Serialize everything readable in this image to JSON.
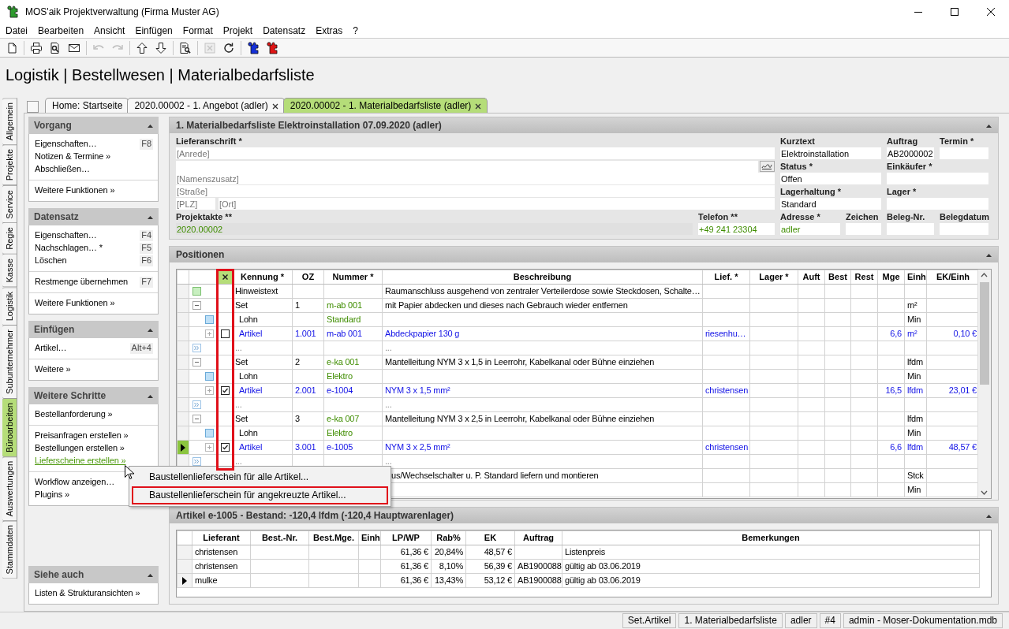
{
  "window": {
    "title": "MOS'aik Projektverwaltung (Firma Muster AG)"
  },
  "menu": [
    "Datei",
    "Bearbeiten",
    "Ansicht",
    "Einfügen",
    "Format",
    "Projekt",
    "Datensatz",
    "Extras",
    "?"
  ],
  "toolbar": {
    "groups": [
      [
        {
          "disabled": false
        }
      ],
      [
        {
          "disabled": false
        },
        {
          "disabled": false
        },
        {
          "disabled": false
        }
      ],
      [
        {
          "disabled": true
        },
        {
          "disabled": true
        }
      ],
      [
        {
          "disabled": false
        },
        {
          "disabled": false
        }
      ],
      [
        {
          "disabled": false
        }
      ],
      [
        {
          "disabled": true
        },
        {
          "disabled": false
        }
      ],
      [
        {
          "disabled": false
        },
        {
          "disabled": false
        }
      ]
    ]
  },
  "heading": "Logistik | Bestellwesen | Materialbedarfsliste",
  "side_tabs": [
    {
      "label": "Allgemein",
      "selected": false
    },
    {
      "label": "Projekte",
      "selected": false
    },
    {
      "label": "Service",
      "selected": false
    },
    {
      "label": "Regie",
      "selected": false
    },
    {
      "label": "Kasse",
      "selected": false
    },
    {
      "label": "Logistik",
      "selected": false
    },
    {
      "label": "Subunternehmer",
      "selected": false
    },
    {
      "label": "Büroarbeiten",
      "selected": true
    },
    {
      "label": "Auswertungen",
      "selected": false
    },
    {
      "label": "Stammdaten",
      "selected": false
    }
  ],
  "doc_tabs": [
    {
      "label": "Home: Startseite",
      "selected": false,
      "closable": false
    },
    {
      "label": "2020.00002 - 1. Angebot (adler)",
      "selected": false,
      "closable": true
    },
    {
      "label": "2020.00002 - 1. Materialbedarfsliste (adler)",
      "selected": true,
      "closable": true
    }
  ],
  "task_pane": [
    {
      "title": "Vorgang",
      "expanded": true,
      "pinned_bottom": false,
      "sections": [
        [
          {
            "label": "Eigenschaften…",
            "shortcut": "F8",
            "active": false
          },
          {
            "label": "Notizen & Termine »",
            "active": false
          },
          {
            "label": "Abschließen…",
            "active": false
          }
        ],
        [
          {
            "label": "Weitere Funktionen »",
            "active": false
          }
        ]
      ]
    },
    {
      "title": "Datensatz",
      "expanded": true,
      "pinned_bottom": false,
      "sections": [
        [
          {
            "label": "Eigenschaften…",
            "shortcut": "F4",
            "active": false
          },
          {
            "label": "Nachschlagen… *",
            "shortcut": "F5",
            "active": false
          },
          {
            "label": "Löschen",
            "shortcut": "F6",
            "active": false
          }
        ],
        [
          {
            "label": "Restmenge übernehmen",
            "shortcut": "F7",
            "active": false
          }
        ],
        [
          {
            "label": "Weitere Funktionen »",
            "active": false
          }
        ]
      ]
    },
    {
      "title": "Einfügen",
      "expanded": true,
      "pinned_bottom": false,
      "sections": [
        [
          {
            "label": "Artikel…",
            "shortcut": "Alt+4",
            "active": false
          }
        ],
        [
          {
            "label": "Weitere »",
            "active": false
          }
        ]
      ]
    },
    {
      "title": "Weitere Schritte",
      "expanded": true,
      "pinned_bottom": false,
      "sections": [
        [
          {
            "label": "Bestellanforderung »",
            "active": false
          }
        ],
        [
          {
            "label": "Preisanfragen erstellen »",
            "active": false
          },
          {
            "label": "Bestellungen erstellen »",
            "active": false
          },
          {
            "label": "Lieferscheine erstellen »",
            "active": true
          }
        ],
        [
          {
            "label": "Workflow anzeigen…",
            "active": false
          },
          {
            "label": "Plugins »",
            "active": false
          }
        ]
      ]
    },
    {
      "title": "Siehe auch",
      "expanded": true,
      "pinned_bottom": true,
      "sections": [
        [
          {
            "label": "Listen & Strukturansichten »",
            "active": false
          }
        ]
      ]
    }
  ],
  "order_form": {
    "title": "1. Materialbedarfsliste Elektroinstallation 07.09.2020 (adler)",
    "expanded": true,
    "address_label": "Lieferanschrift *",
    "address_lines": [
      {
        "kind": "text",
        "placeholder": "[Anrede]"
      },
      {
        "kind": "signature"
      },
      {
        "kind": "text",
        "placeholder": "[Namenszusatz]"
      },
      {
        "kind": "text",
        "placeholder": "[Straße]"
      },
      {
        "kind": "zip_city",
        "zip_placeholder": "[PLZ]",
        "city_placeholder": "[Ort]"
      }
    ],
    "fields": [
      {
        "label": "Kurztext",
        "value": "Elektroinstallation"
      },
      {
        "label": "Auftrag",
        "value": "AB2000002"
      },
      {
        "label": "Termin *"
      },
      {
        "label": "Status *",
        "value": "Offen"
      },
      {
        "label": "Einkäufer *"
      },
      {
        "label": "Lagerhaltung *",
        "value": "Standard"
      },
      {
        "label": "Lager *"
      }
    ],
    "bottom_fields": [
      {
        "label": "Projektakte **",
        "value": "2020.00002",
        "linked": true,
        "readonly": true
      },
      {
        "label": "Telefon **",
        "value": "+49 241 23304",
        "linked": true,
        "readonly": false
      },
      {
        "label": "Adresse *",
        "value": "adler",
        "linked": true,
        "readonly": false
      },
      {
        "label": "Zeichen",
        "linked": false,
        "readonly": false
      },
      {
        "label": "Beleg-Nr.",
        "linked": false,
        "readonly": false
      },
      {
        "label": "Belegdatum",
        "linked": false,
        "readonly": false
      }
    ]
  },
  "positions": {
    "title": "Positionen",
    "expanded": true,
    "check_column": {
      "highlighted": true
    },
    "columns": [
      "Kennung *",
      "OZ",
      "Nummer *",
      "Beschreibung",
      "Lief. *",
      "Lager *",
      "Auft",
      "Best",
      "Rest",
      "Mge",
      "Einh",
      "EK/Einh"
    ],
    "rows": [
      {
        "kind": "hint",
        "selected": false,
        "covered": false,
        "kennung": "Hinweistext",
        "beschreibung": "Raumanschluss ausgehend von zentraler Verteilerdose sowie Steckdosen, Schalte…"
      },
      {
        "kind": "set",
        "selected": false,
        "covered": false,
        "kennung": "Set",
        "oz": "1",
        "nummer": "m-ab 001",
        "beschreibung": "mit Papier abdecken und dieses nach Gebrauch wieder entfernen",
        "einh": "m²"
      },
      {
        "kind": "lohn",
        "selected": false,
        "covered": false,
        "kennung": "Lohn",
        "nummer": "Standard",
        "einh": "Min"
      },
      {
        "kind": "artikel",
        "selected": false,
        "covered": false,
        "checked": false,
        "kennung": "Artikel",
        "oz": "1.001",
        "nummer": "m-ab 001",
        "beschreibung": "Abdeckpapier 130 g",
        "lief": "riesenhu…",
        "mge": "6,6",
        "einh": "m²",
        "ek": "0,10 €"
      },
      {
        "kind": "more",
        "selected": false,
        "covered": false,
        "kennung": "...",
        "beschreibung": "..."
      },
      {
        "kind": "set",
        "selected": false,
        "covered": false,
        "kennung": "Set",
        "oz": "2",
        "nummer": "e-ka 001",
        "beschreibung": "Mantelleitung NYM 3 x 1,5 in Leerrohr, Kabelkanal oder Bühne einziehen",
        "einh": "lfdm"
      },
      {
        "kind": "lohn",
        "selected": false,
        "covered": false,
        "kennung": "Lohn",
        "nummer": "Elektro",
        "einh": "Min"
      },
      {
        "kind": "artikel",
        "selected": false,
        "covered": false,
        "checked": true,
        "kennung": "Artikel",
        "oz": "2.001",
        "nummer": "e-1004",
        "beschreibung": "NYM 3 x 1,5 mm²",
        "lief": "christensen",
        "mge": "16,5",
        "einh": "lfdm",
        "ek": "23,01 €"
      },
      {
        "kind": "more",
        "selected": false,
        "covered": false,
        "kennung": "...",
        "beschreibung": "..."
      },
      {
        "kind": "set",
        "selected": false,
        "covered": false,
        "kennung": "Set",
        "oz": "3",
        "nummer": "e-ka 007",
        "beschreibung": "Mantelleitung NYM 3 x 2,5 in Leerrohr, Kabelkanal oder Bühne einziehen",
        "einh": "lfdm"
      },
      {
        "kind": "lohn",
        "selected": false,
        "covered": false,
        "kennung": "Lohn",
        "nummer": "Elektro",
        "einh": "Min"
      },
      {
        "kind": "artikel",
        "selected": true,
        "covered": false,
        "checked": true,
        "kennung": "Artikel",
        "oz": "3.001",
        "nummer": "e-1005",
        "beschreibung": "NYM 3 x 2,5 mm²",
        "lief": "christensen",
        "mge": "6,6",
        "einh": "lfdm",
        "ek": "48,57 €"
      },
      {
        "kind": "more",
        "selected": false,
        "covered": false,
        "kennung": "...",
        "beschreibung": "..."
      },
      {
        "kind": "set",
        "selected": false,
        "covered": true,
        "beschreibung": "us/Wechselschalter u. P. Standard liefern und montieren",
        "einh": "Stck"
      },
      {
        "kind": "lohn",
        "selected": false,
        "covered": true,
        "einh": "Min"
      }
    ]
  },
  "article_info": {
    "title": "Artikel e-1005 - Bestand: -120,4 lfdm (-120,4 Hauptwarenlager)",
    "expanded": true,
    "columns": [
      "Lieferant",
      "Best.-Nr.",
      "Best.Mge.",
      "Einh",
      "LP/WP",
      "Rab%",
      "EK",
      "Auftrag",
      "Bemerkungen"
    ],
    "rows": [
      {
        "selected": false,
        "lieferant": "christensen",
        "lp_wp": "61,36 €",
        "rab": "20,84%",
        "ek": "48,57 €",
        "bemerkungen": "Listenpreis"
      },
      {
        "selected": false,
        "lieferant": "christensen",
        "lp_wp": "61,36 €",
        "rab": "8,10%",
        "ek": "56,39 €",
        "auftrag": "AB1900088",
        "bemerkungen": "gültig ab 03.06.2019"
      },
      {
        "selected": true,
        "lieferant": "mulke",
        "lp_wp": "61,36 €",
        "rab": "13,43%",
        "ek": "53,12 €",
        "auftrag": "AB1900088",
        "bemerkungen": "gültig ab 03.06.2019"
      }
    ]
  },
  "context_menu": {
    "items": [
      {
        "label": "Baustellenlieferschein für alle Artikel...",
        "highlighted": false
      },
      {
        "label": "Baustellenlieferschein für angekreuzte Artikel...",
        "highlighted": true
      }
    ]
  },
  "status_bar": [
    "Set.Artikel",
    "1. Materialbedarfsliste",
    "adler",
    "#4",
    "admin - Moser-Dokumentation.mdb"
  ]
}
